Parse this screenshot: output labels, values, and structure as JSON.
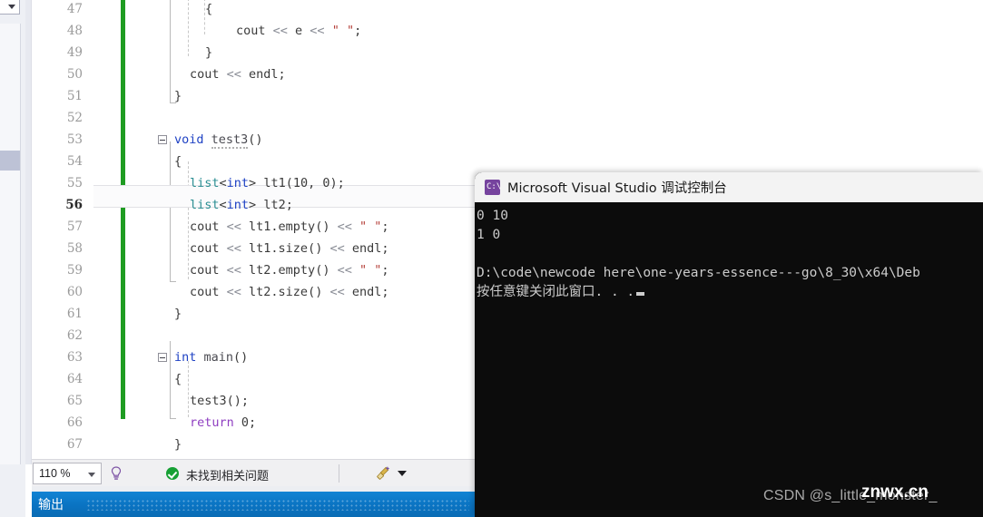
{
  "editor": {
    "gutter_first_line": 47,
    "lines": [
      {
        "num": 47,
        "indent": 3,
        "tokens": [
          {
            "t": "{",
            "c": "pl"
          }
        ]
      },
      {
        "num": 48,
        "indent": 5,
        "tokens": [
          {
            "t": "cout ",
            "c": "pl"
          },
          {
            "t": "<< ",
            "c": "op"
          },
          {
            "t": "e ",
            "c": "pl"
          },
          {
            "t": "<< ",
            "c": "op"
          },
          {
            "t": "\" \"",
            "c": "str"
          },
          {
            "t": ";",
            "c": "pl"
          }
        ]
      },
      {
        "num": 49,
        "indent": 3,
        "tokens": [
          {
            "t": "}",
            "c": "pl"
          }
        ]
      },
      {
        "num": 50,
        "indent": 2,
        "tokens": [
          {
            "t": "cout ",
            "c": "pl"
          },
          {
            "t": "<< ",
            "c": "op"
          },
          {
            "t": "endl",
            "c": "pl"
          },
          {
            "t": ";",
            "c": "pl"
          }
        ]
      },
      {
        "num": 51,
        "indent": 1,
        "tokens": [
          {
            "t": "}",
            "c": "pl"
          }
        ]
      },
      {
        "num": 52,
        "indent": 0,
        "tokens": []
      },
      {
        "num": 53,
        "indent": 1,
        "tokens": [
          {
            "t": "void ",
            "c": "kw"
          },
          {
            "t": "test3",
            "c": "fn squig"
          },
          {
            "t": "()",
            "c": "pl"
          }
        ]
      },
      {
        "num": 54,
        "indent": 1,
        "tokens": [
          {
            "t": "{",
            "c": "pl"
          }
        ]
      },
      {
        "num": 55,
        "indent": 2,
        "tokens": [
          {
            "t": "list",
            "c": "typ"
          },
          {
            "t": "<",
            "c": "pl"
          },
          {
            "t": "int",
            "c": "kw"
          },
          {
            "t": "> ",
            "c": "pl"
          },
          {
            "t": "lt1(",
            "c": "pl"
          },
          {
            "t": "10",
            "c": "pl"
          },
          {
            "t": ", ",
            "c": "pl"
          },
          {
            "t": "0",
            "c": "pl"
          },
          {
            "t": ");",
            "c": "pl"
          }
        ]
      },
      {
        "num": 56,
        "indent": 2,
        "current": true,
        "tokens": [
          {
            "t": "list",
            "c": "typ"
          },
          {
            "t": "<",
            "c": "pl"
          },
          {
            "t": "int",
            "c": "kw"
          },
          {
            "t": "> ",
            "c": "pl"
          },
          {
            "t": "lt2;",
            "c": "pl"
          }
        ]
      },
      {
        "num": 57,
        "indent": 2,
        "tokens": [
          {
            "t": "cout ",
            "c": "pl"
          },
          {
            "t": "<< ",
            "c": "op"
          },
          {
            "t": "lt1.",
            "c": "pl"
          },
          {
            "t": "empty",
            "c": "pl"
          },
          {
            "t": "() ",
            "c": "pl"
          },
          {
            "t": "<< ",
            "c": "op"
          },
          {
            "t": "\" \"",
            "c": "str"
          },
          {
            "t": ";",
            "c": "pl"
          }
        ]
      },
      {
        "num": 58,
        "indent": 2,
        "tokens": [
          {
            "t": "cout ",
            "c": "pl"
          },
          {
            "t": "<< ",
            "c": "op"
          },
          {
            "t": "lt1.",
            "c": "pl"
          },
          {
            "t": "size",
            "c": "pl"
          },
          {
            "t": "() ",
            "c": "pl"
          },
          {
            "t": "<< ",
            "c": "op"
          },
          {
            "t": "endl;",
            "c": "pl"
          }
        ]
      },
      {
        "num": 59,
        "indent": 2,
        "tokens": [
          {
            "t": "cout ",
            "c": "pl"
          },
          {
            "t": "<< ",
            "c": "op"
          },
          {
            "t": "lt2.",
            "c": "pl"
          },
          {
            "t": "empty",
            "c": "pl"
          },
          {
            "t": "() ",
            "c": "pl"
          },
          {
            "t": "<< ",
            "c": "op"
          },
          {
            "t": "\" \"",
            "c": "str"
          },
          {
            "t": ";",
            "c": "pl"
          }
        ]
      },
      {
        "num": 60,
        "indent": 2,
        "tokens": [
          {
            "t": "cout ",
            "c": "pl"
          },
          {
            "t": "<< ",
            "c": "op"
          },
          {
            "t": "lt2.",
            "c": "pl"
          },
          {
            "t": "size",
            "c": "pl"
          },
          {
            "t": "() ",
            "c": "pl"
          },
          {
            "t": "<< ",
            "c": "op"
          },
          {
            "t": "endl;",
            "c": "pl"
          }
        ]
      },
      {
        "num": 61,
        "indent": 1,
        "tokens": [
          {
            "t": "}",
            "c": "pl"
          }
        ]
      },
      {
        "num": 62,
        "indent": 0,
        "tokens": []
      },
      {
        "num": 63,
        "indent": 1,
        "tokens": [
          {
            "t": "int ",
            "c": "kw"
          },
          {
            "t": "main",
            "c": "fn"
          },
          {
            "t": "()",
            "c": "pl"
          }
        ]
      },
      {
        "num": 64,
        "indent": 1,
        "tokens": [
          {
            "t": "{",
            "c": "pl"
          }
        ]
      },
      {
        "num": 65,
        "indent": 2,
        "tokens": [
          {
            "t": "test3",
            "c": "pl"
          },
          {
            "t": "();",
            "c": "pl"
          }
        ]
      },
      {
        "num": 66,
        "indent": 2,
        "tokens": [
          {
            "t": "return ",
            "c": "kw2"
          },
          {
            "t": "0;",
            "c": "pl"
          }
        ]
      },
      {
        "num": 67,
        "indent": 1,
        "tokens": [
          {
            "t": "}",
            "c": "pl"
          }
        ]
      }
    ],
    "collapse_rows": [
      53,
      63
    ],
    "change_bar_color": "#1f9c22"
  },
  "statusbar": {
    "zoom_value": "110 %",
    "bulb_icon": "lightbulb-icon",
    "status_icon": "check-circle-icon",
    "status_text": "未找到相关问题",
    "broom_icon": "broom-icon",
    "broom_caret_icon": "chevron-down-icon"
  },
  "output_panel": {
    "title": "输出",
    "header_color": "#0a73c2"
  },
  "console": {
    "icon_name": "console-app-icon",
    "icon_glyph": "C:\\",
    "title": "Microsoft Visual Studio 调试控制台",
    "lines": [
      "0 10",
      "1 0",
      "",
      "D:\\code\\newcode here\\one-years-essence---go\\8_30\\x64\\Deb",
      "按任意键关闭此窗口. . ."
    ],
    "background": "#0c0c0c",
    "text_color": "#cccccc"
  },
  "watermarks": {
    "csdn": "CSDN @s_little_monster_",
    "site": "znwx.cn"
  },
  "chrome": {
    "dropdown_glyph": "⌄",
    "dropdown_caret_icon": "chevron-down-icon"
  }
}
